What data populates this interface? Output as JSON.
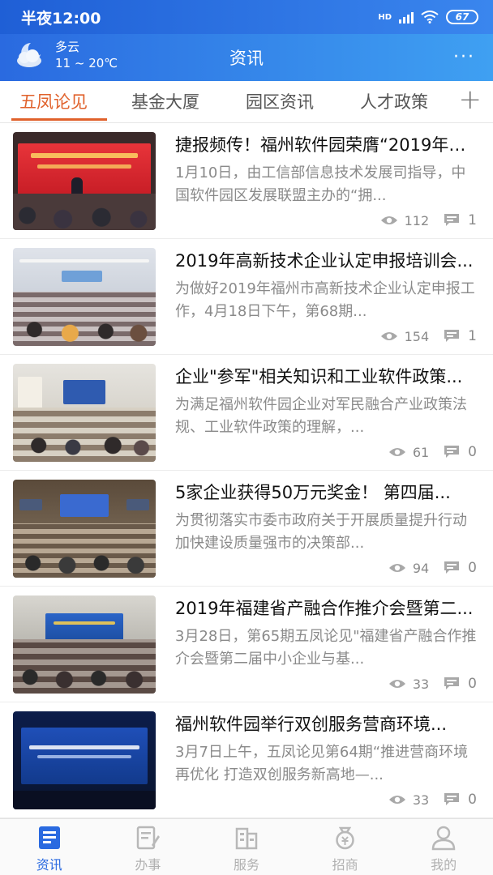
{
  "status_bar": {
    "time": "半夜12:00",
    "network": "HD",
    "battery": "67"
  },
  "header": {
    "weather": {
      "condition": "多云",
      "temperature": "11 ~ 20℃",
      "icon": "cloud-moon-icon"
    },
    "title": "资讯",
    "more_label": "···"
  },
  "tabs": [
    {
      "label": "五凤论见",
      "active": true
    },
    {
      "label": "基金大厦",
      "active": false
    },
    {
      "label": "园区资讯",
      "active": false
    },
    {
      "label": "人才政策",
      "active": false
    }
  ],
  "add_tab_label": "+",
  "news": [
    {
      "title": "捷报频传！福州软件园荣膺“2019年度...",
      "summary": "1月10日，由工信部信息技术发展司指导，中国软件园区发展联盟主办的“拥...",
      "views": "112",
      "comments": "1"
    },
    {
      "title": "2019年高新技术企业认定申报培训会...",
      "summary": "为做好2019年福州市高新技术企业认定申报工作，4月18日下午，第68期...",
      "views": "154",
      "comments": "1"
    },
    {
      "title": "企业\"参军\"相关知识和工业软件政策...",
      "summary": "为满足福州软件园企业对军民融合产业政策法规、工业软件政策的理解，...",
      "views": "61",
      "comments": "0"
    },
    {
      "title": "5家企业获得50万元奖金！ 第四届...",
      "summary": "为贯彻落实市委市政府关于开展质量提升行动加快建设质量强市的决策部...",
      "views": "94",
      "comments": "0"
    },
    {
      "title": "2019年福建省产融合作推介会暨第二...",
      "summary": "3月28日，第65期五凤论见\"福建省产融合作推介会暨第二届中小企业与基...",
      "views": "33",
      "comments": "0"
    },
    {
      "title": "福州软件园举行双创服务营商环境...",
      "summary": "3月7日上午，五凤论见第64期“推进营商环境再优化 打造双创服务新高地—...",
      "views": "33",
      "comments": "0"
    }
  ],
  "bottom_nav": [
    {
      "label": "资讯",
      "icon": "news-icon",
      "active": true
    },
    {
      "label": "办事",
      "icon": "edit-doc-icon",
      "active": false
    },
    {
      "label": "服务",
      "icon": "building-icon",
      "active": false
    },
    {
      "label": "招商",
      "icon": "money-bag-icon",
      "active": false
    },
    {
      "label": "我的",
      "icon": "user-icon",
      "active": false
    }
  ],
  "colors": {
    "brand_blue": "#2a6ae0",
    "tab_active": "#e0612b",
    "muted": "#8a8a8a"
  }
}
